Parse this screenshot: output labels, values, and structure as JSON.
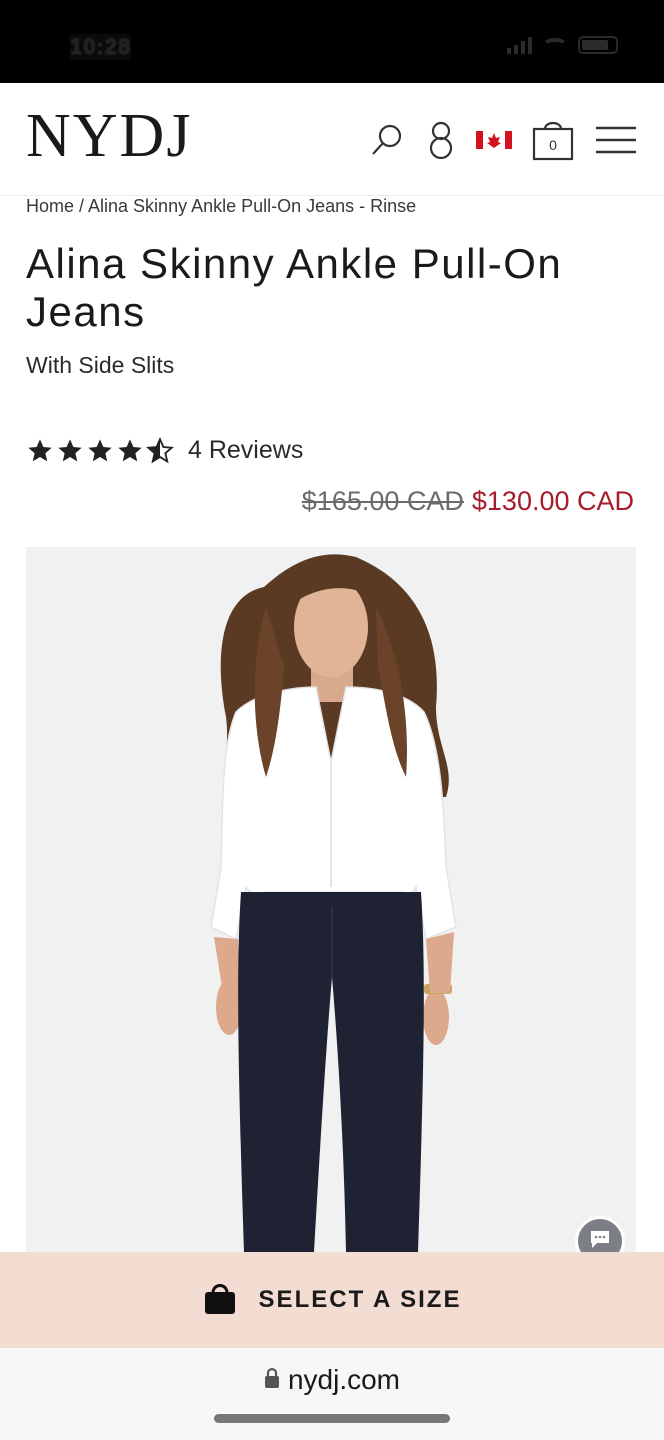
{
  "status_bar": {
    "time": "10:28"
  },
  "header": {
    "logo": "NYDJ",
    "icons": [
      "search-icon",
      "account-icon",
      "canada-flag-icon",
      "shopping-bag-icon",
      "menu-icon"
    ],
    "cart_count": "0"
  },
  "breadcrumb": "Home / Alina Skinny Ankle Pull-On Jeans - Rinse",
  "product": {
    "title": "Alina Skinny Ankle Pull-On Jeans",
    "subtitle": "With Side Slits",
    "rating": 4.5,
    "reviews_label": "4 Reviews",
    "price_original": "$165.00 CAD",
    "price_sale": "$130.00 CAD",
    "colors": {
      "sale_price": "#a51d2d",
      "select_bar": "#f3ddd3"
    }
  },
  "select_size": {
    "label": "SELECT A SIZE"
  },
  "browser": {
    "url": "nydj.com"
  }
}
